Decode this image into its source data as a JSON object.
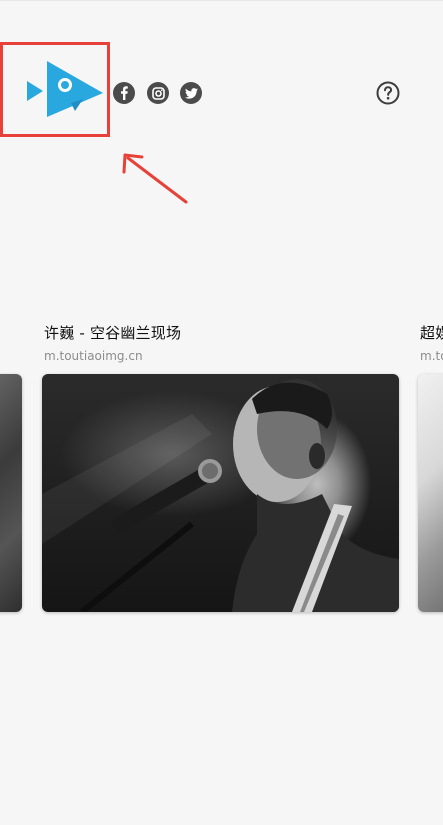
{
  "header": {
    "logo_icon": "fish-play-logo",
    "social_icons": [
      "facebook-icon",
      "instagram-icon",
      "twitter-icon"
    ],
    "help_icon": "question-circle-icon"
  },
  "cards": [
    {
      "title": "",
      "domain": "",
      "image": "guitar-wall-partial"
    },
    {
      "title": "许巍 - 空谷幽兰现场",
      "domain": "m.toutiaoimg.cn",
      "image": "singer-with-microphone-bw"
    },
    {
      "title": "超娱",
      "domain": "m.to",
      "image": "partial-bw-photo"
    }
  ],
  "colors": {
    "logo_blue": "#29a8e0",
    "highlight_red": "#e8413a",
    "icon_dark": "#4b4b4b",
    "background": "#f6f6f6"
  }
}
